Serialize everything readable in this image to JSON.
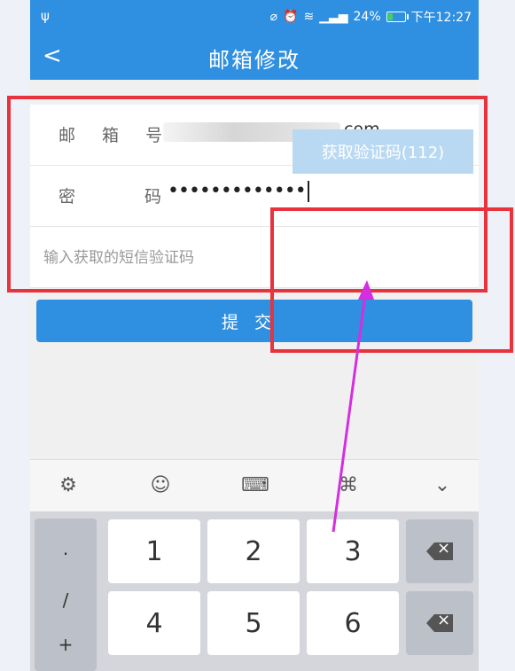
{
  "status_bar": {
    "usb_icon": "usb-icon",
    "battery": "24%",
    "time": "下午12:27"
  },
  "header": {
    "title": "邮箱修改",
    "back_icon": "chevron-left-icon"
  },
  "form": {
    "email_label": "邮 箱 号",
    "email_suffix": "com",
    "password_label": "密 码",
    "password_value": "•••••••••••••",
    "sms_placeholder": "输入获取的短信验证码",
    "get_code_button": "获取验证码(112)"
  },
  "submit_button": "提交",
  "keyboard": {
    "toolbar_icons": [
      "gear-icon",
      "emoji-icon",
      "keyboard-icon",
      "command-icon",
      "chevron-down-icon"
    ],
    "left_symbols": [
      "·",
      "/",
      "+"
    ],
    "digits": [
      "1",
      "2",
      "3",
      "4",
      "5",
      "6"
    ]
  },
  "colors": {
    "primary": "#2f8fe0",
    "highlight": "#e8323c",
    "arrow": "#d42ee0"
  }
}
